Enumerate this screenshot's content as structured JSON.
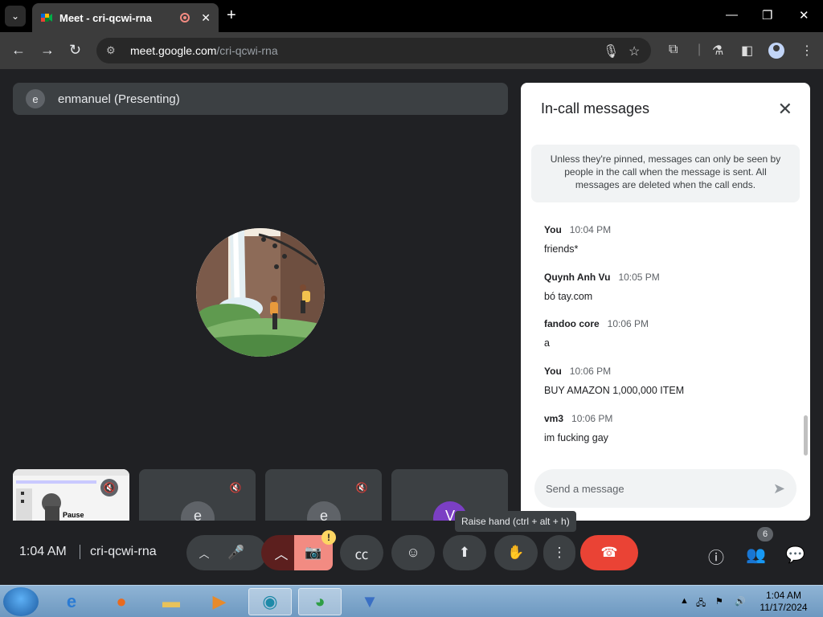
{
  "browser": {
    "tab_title": "Meet - cri-qcwi-rna",
    "tab_dropdown_icon": "chevron-down-icon",
    "new_tab_icon": "plus-icon",
    "url_host": "meet.google.com",
    "url_path": "/cri-qcwi-rna",
    "window_controls": [
      "minimize",
      "restore",
      "close"
    ]
  },
  "presenting": {
    "avatar_letter": "e",
    "label": "enmanuel (Presenting)"
  },
  "thumbnails": [
    {
      "type": "screen",
      "label": "Pause"
    },
    {
      "type": "avatar",
      "letter": "e"
    },
    {
      "type": "avatar",
      "letter": "e"
    },
    {
      "type": "avatar",
      "letter": "V",
      "color": "#7b3fc4"
    }
  ],
  "chat": {
    "title": "In-call messages",
    "notice": "Unless they're pinned, messages can only be seen by people in the call when the message is sent. All messages are deleted when the call ends.",
    "messages": [
      {
        "sender": "You",
        "time": "10:04 PM",
        "text": "friends*"
      },
      {
        "sender": "Quynh Anh Vu",
        "time": "10:05 PM",
        "text": "bó tay.com"
      },
      {
        "sender": "fandoo core",
        "time": "10:06 PM",
        "text": "a"
      },
      {
        "sender": "You",
        "time": "10:06 PM",
        "text": "BUY AMAZON 1,000,000 ITEM"
      },
      {
        "sender": "vm3",
        "time": "10:06 PM",
        "text": "im fucking gay"
      }
    ],
    "input_placeholder": "Send a message"
  },
  "controls": {
    "time": "1:04 AM",
    "meeting_code": "cri-qcwi-rna",
    "tooltip": "Raise hand (ctrl + alt + h)",
    "warning_badge": "!",
    "people_count": "6"
  },
  "taskbar": {
    "clock_time": "1:04 AM",
    "clock_date": "11/17/2024"
  },
  "colors": {
    "meet_bg": "#202124",
    "end_call": "#ea4335",
    "camera_off": "#f28b82",
    "chat_bg": "#ffffff"
  }
}
